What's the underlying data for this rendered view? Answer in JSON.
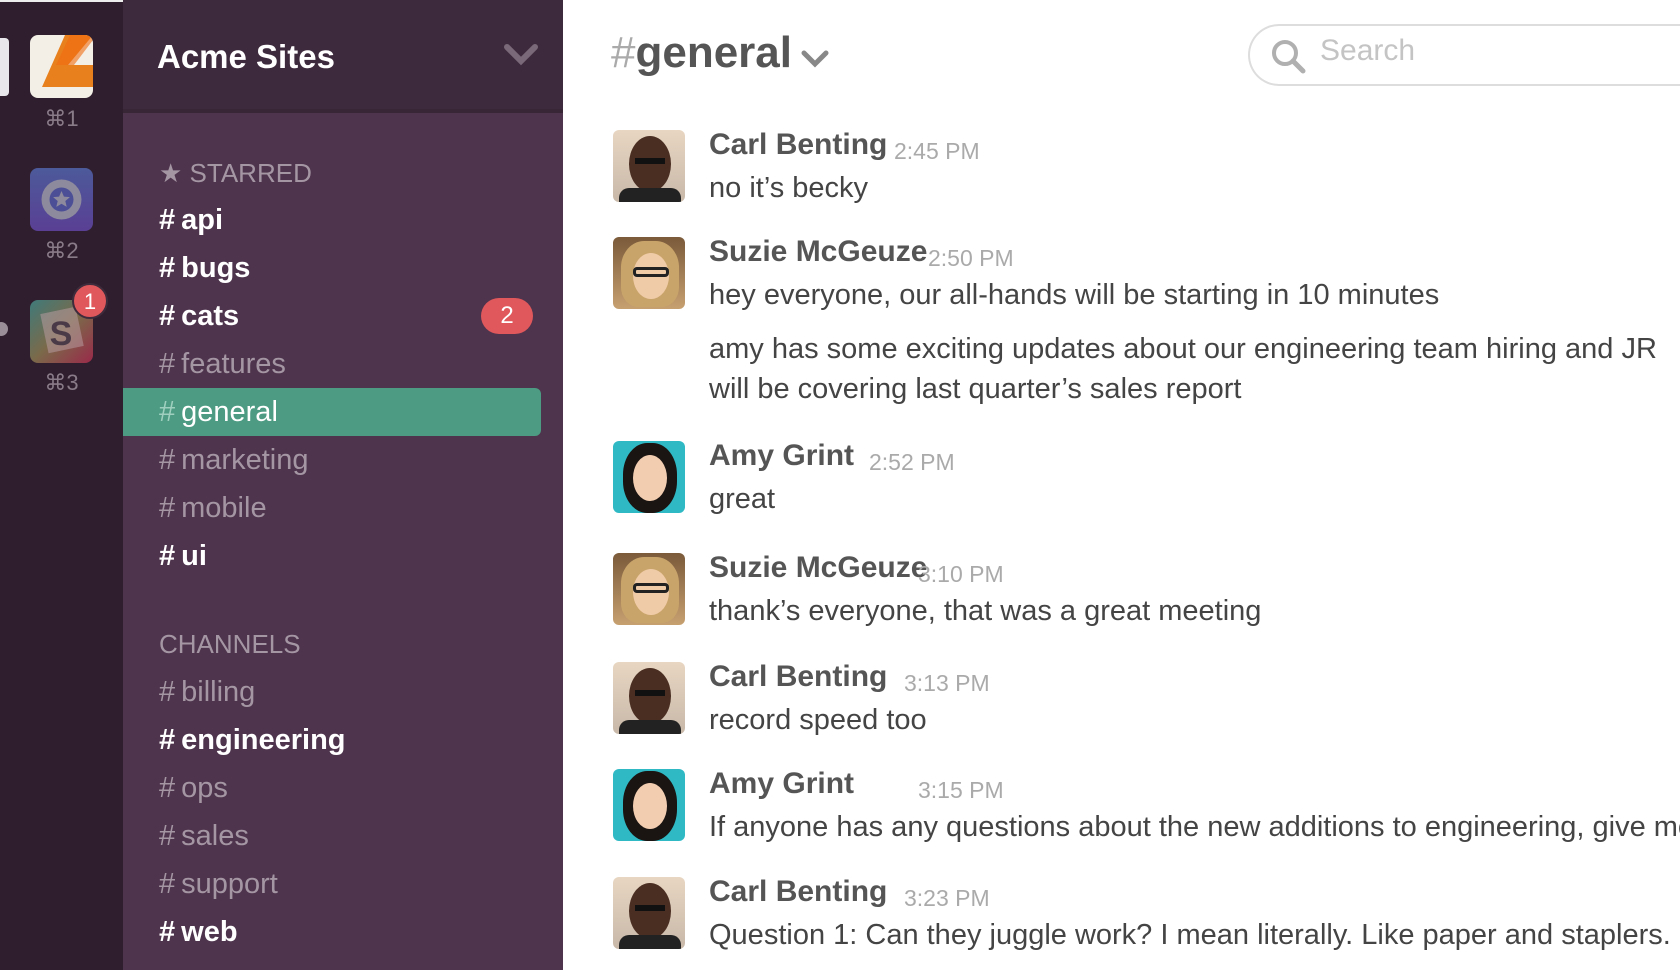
{
  "teams": [
    {
      "key": "⌘1",
      "icon": "orange-logo-icon"
    },
    {
      "key": "⌘2",
      "icon": "star-badge-logo-icon"
    },
    {
      "key": "⌘3",
      "icon": "slack-logo-icon",
      "badge": "1"
    }
  ],
  "sidebar": {
    "team_name": "Acme Sites",
    "starred_label": "STARRED",
    "channels_label": "CHANNELS",
    "starred": [
      {
        "name": "api",
        "bold": true
      },
      {
        "name": "bugs",
        "bold": true
      },
      {
        "name": "cats",
        "bold": true,
        "badge": "2"
      },
      {
        "name": "features"
      },
      {
        "name": "general",
        "active": true
      },
      {
        "name": "marketing"
      },
      {
        "name": "mobile"
      },
      {
        "name": "ui",
        "bold": true
      }
    ],
    "channels": [
      {
        "name": "billing"
      },
      {
        "name": "engineering",
        "bold": true
      },
      {
        "name": "ops"
      },
      {
        "name": "sales"
      },
      {
        "name": "support"
      },
      {
        "name": "web",
        "bold": true
      }
    ]
  },
  "header": {
    "hash": "#",
    "channel": "general",
    "search_placeholder": "Search"
  },
  "colors": {
    "rail": "#2f1f2e",
    "sidebar": "#4e344d",
    "active": "#4c9b82",
    "badge": "#e0585b"
  },
  "messages": [
    {
      "author": "Carl Benting",
      "time": "2:45 PM",
      "avatar": "carl",
      "lines": [
        "no it’s becky"
      ]
    },
    {
      "author": "Suzie McGeuze",
      "time": "2:50 PM",
      "avatar": "suzie",
      "lines": [
        "hey everyone, our all-hands will be starting in 10 minutes",
        "amy has some exciting updates about our engineering team hiring and JR",
        "will be covering last quarter’s sales report"
      ]
    },
    {
      "author": "Amy Grint",
      "time": "2:52 PM",
      "avatar": "amy",
      "lines": [
        "great"
      ]
    },
    {
      "author": "Suzie McGeuze",
      "time": "3:10 PM",
      "avatar": "suzie",
      "lines": [
        "thank’s everyone, that was a great meeting"
      ]
    },
    {
      "author": "Carl Benting",
      "time": "3:13 PM",
      "avatar": "carl",
      "lines": [
        "record speed too"
      ]
    },
    {
      "author": "Amy Grint",
      "time": "3:15 PM",
      "avatar": "amy",
      "lines": [
        "If anyone has any questions about the new additions to engineering, give me"
      ]
    },
    {
      "author": "Carl Benting",
      "time": "3:23 PM",
      "avatar": "carl",
      "lines": [
        "Question 1: Can they juggle work? I mean literally. Like paper and staplers."
      ]
    }
  ]
}
